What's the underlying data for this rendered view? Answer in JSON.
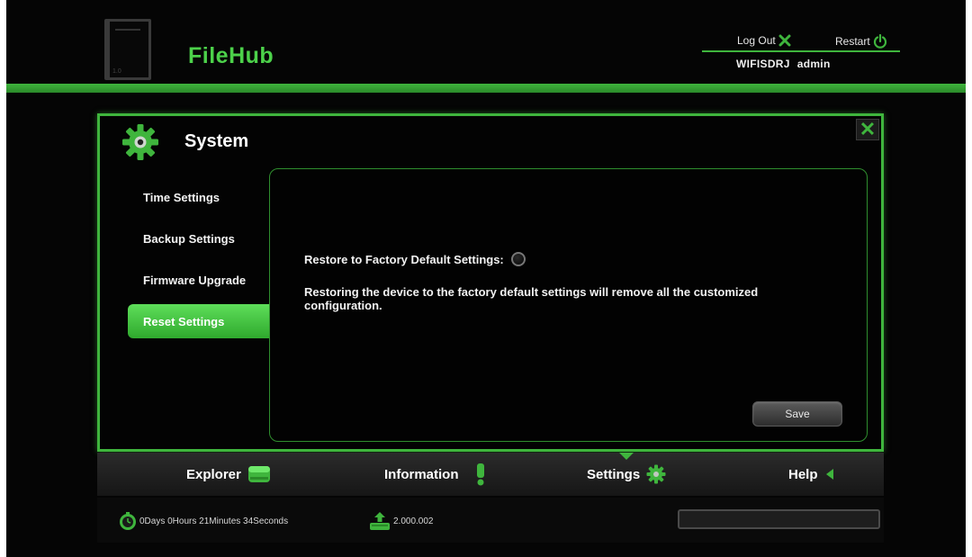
{
  "header": {
    "brand": "FileHub",
    "logout_label": "Log Out",
    "restart_label": "Restart",
    "ssid": "WIFISDRJ",
    "user": "admin"
  },
  "panel": {
    "title": "System",
    "menu": [
      {
        "label": "Time Settings"
      },
      {
        "label": "Backup Settings"
      },
      {
        "label": "Firmware Upgrade"
      },
      {
        "label": "Reset Settings",
        "active": true
      }
    ],
    "content": {
      "restore_label": "Restore to Factory Default Settings:",
      "description": "Restoring the device to the factory default settings will remove all the customized configuration.",
      "save_label": "Save"
    }
  },
  "nav": {
    "items": [
      {
        "label": "Explorer",
        "icon": "drive-icon"
      },
      {
        "label": "Information",
        "icon": "exclamation-icon"
      },
      {
        "label": "Settings",
        "icon": "gear-icon"
      },
      {
        "label": "Help",
        "icon": "arrow-left-icon"
      }
    ]
  },
  "status": {
    "uptime": "0Days 0Hours 21Minutes 34Seconds",
    "version": "2.000.002"
  },
  "colors": {
    "accent": "#3fb53d",
    "accent_light": "#5ede5a",
    "background": "#050505",
    "text": "#f2f2f2"
  }
}
